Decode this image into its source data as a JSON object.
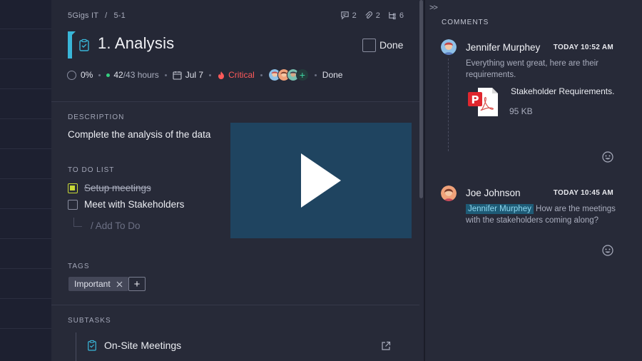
{
  "breadcrumb": {
    "project": "5Gigs IT",
    "separator": "/",
    "task_id": "5-1"
  },
  "counts": {
    "comments": "2",
    "attachments": "2",
    "subtasks": "6"
  },
  "task": {
    "title": "1. Analysis",
    "done_label": "Done",
    "progress": "0%",
    "hours_done": "42",
    "hours_total": "/43 hours",
    "due": "Jul 7",
    "priority": "Critical",
    "status": "Done"
  },
  "description": {
    "label": "DESCRIPTION",
    "text": "Complete the analysis of the data"
  },
  "todo": {
    "label": "TO DO LIST",
    "items": [
      {
        "text": "Setup meetings",
        "checked": true
      },
      {
        "text": "Meet with Stakeholders",
        "checked": false
      }
    ],
    "add_placeholder": "/ Add To Do"
  },
  "tags": {
    "label": "TAGS",
    "items": [
      "Important"
    ],
    "add": "+"
  },
  "subtasks": {
    "label": "SUBTASKS",
    "items": [
      "On-Site Meetings"
    ]
  },
  "comments": {
    "title": "COMMENTS",
    "collapse": ">>",
    "items": [
      {
        "author": "Jennifer Murphey",
        "time": "TODAY 10:52 AM",
        "text": "Everything went great, here are their requirements.",
        "file_name": "Stakeholder Requirements.",
        "file_size": "95 KB"
      },
      {
        "author": "Joe Johnson",
        "time": "TODAY 10:45 AM",
        "mention": "Jennifer Murphey",
        "text": " How are the meetings with the stakeholders coming along?"
      }
    ]
  },
  "colors": {
    "accent": "#39b6d8",
    "critical": "#ff5a5a",
    "todo_check": "#c8d936",
    "video_bg": "#1f4460"
  }
}
